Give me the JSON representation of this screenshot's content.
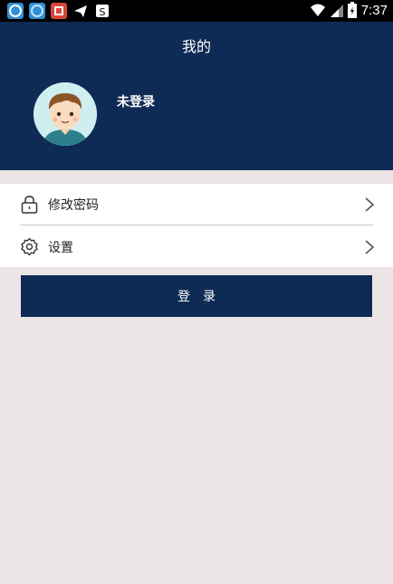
{
  "status_bar": {
    "time": "7:37",
    "notification_icons": [
      {
        "name": "app-icon-1",
        "color": "#2f8fd6"
      },
      {
        "name": "app-icon-2",
        "color": "#2f8fd6"
      },
      {
        "name": "app-icon-3",
        "color": "#d9443b"
      },
      {
        "name": "telegram-icon",
        "color": "#ffffff"
      },
      {
        "name": "app-icon-s",
        "color": "#ffffff"
      }
    ]
  },
  "header": {
    "title": "我的",
    "login_status": "未登录",
    "background": "#0e2b55"
  },
  "menu": {
    "items": [
      {
        "label": "修改密码",
        "icon": "lock-icon"
      },
      {
        "label": "设置",
        "icon": "gear-icon"
      }
    ]
  },
  "login_button": {
    "label": "登录"
  }
}
